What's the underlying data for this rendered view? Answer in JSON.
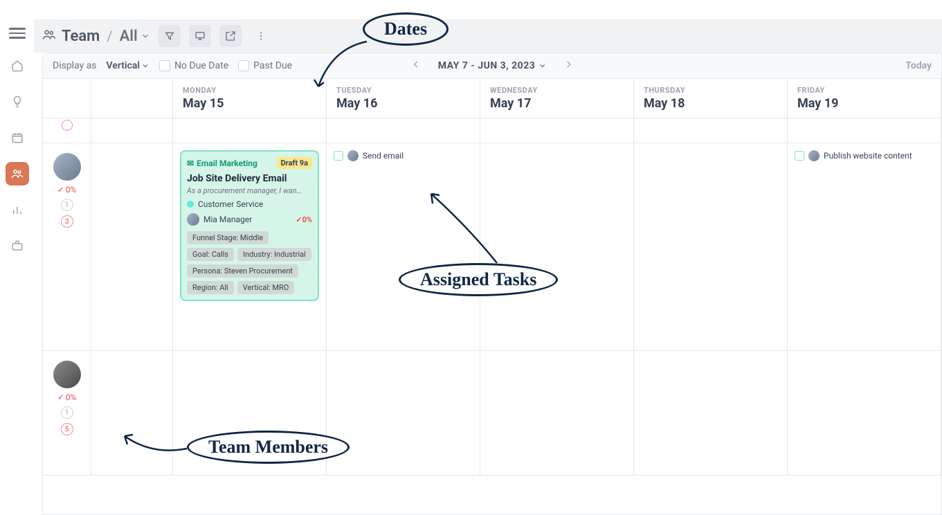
{
  "topbar": {
    "title": "Team",
    "all": "All"
  },
  "settings": {
    "display_as": "Display as",
    "mode": "Vertical",
    "no_due": "No Due Date",
    "past_due": "Past Due",
    "range": "MAY 7 - JUN 3, 2023",
    "today": "Today"
  },
  "days": [
    {
      "dow": "MONDAY",
      "date": "May 15"
    },
    {
      "dow": "TUESDAY",
      "date": "May 16"
    },
    {
      "dow": "WEDNESDAY",
      "date": "May 17"
    },
    {
      "dow": "THURSDAY",
      "date": "May 18"
    },
    {
      "dow": "FRIDAY",
      "date": "May 19"
    }
  ],
  "members": [
    {
      "pct": "0%",
      "b1": "1",
      "b2": "3"
    },
    {
      "pct": "0%",
      "b1": "1",
      "b2": "5"
    }
  ],
  "card": {
    "category": "Email Marketing",
    "status": "Draft",
    "time": "9a",
    "title": "Job Site Delivery Email",
    "desc": "As a procurement manager, I wan…",
    "service": "Customer Service",
    "assignee": "Mia Manager",
    "pct": "0%",
    "tags": [
      "Funnel Stage: Middle",
      "Goal: Calls",
      "Industry: Industrial",
      "Persona: Steven Procurement",
      "Region: All",
      "Vertical: MRO"
    ]
  },
  "tasks": {
    "send_email": "Send email",
    "publish": "Publish website content"
  },
  "annotations": {
    "dates": "Dates",
    "assigned": "Assigned Tasks",
    "team": "Team Members"
  }
}
